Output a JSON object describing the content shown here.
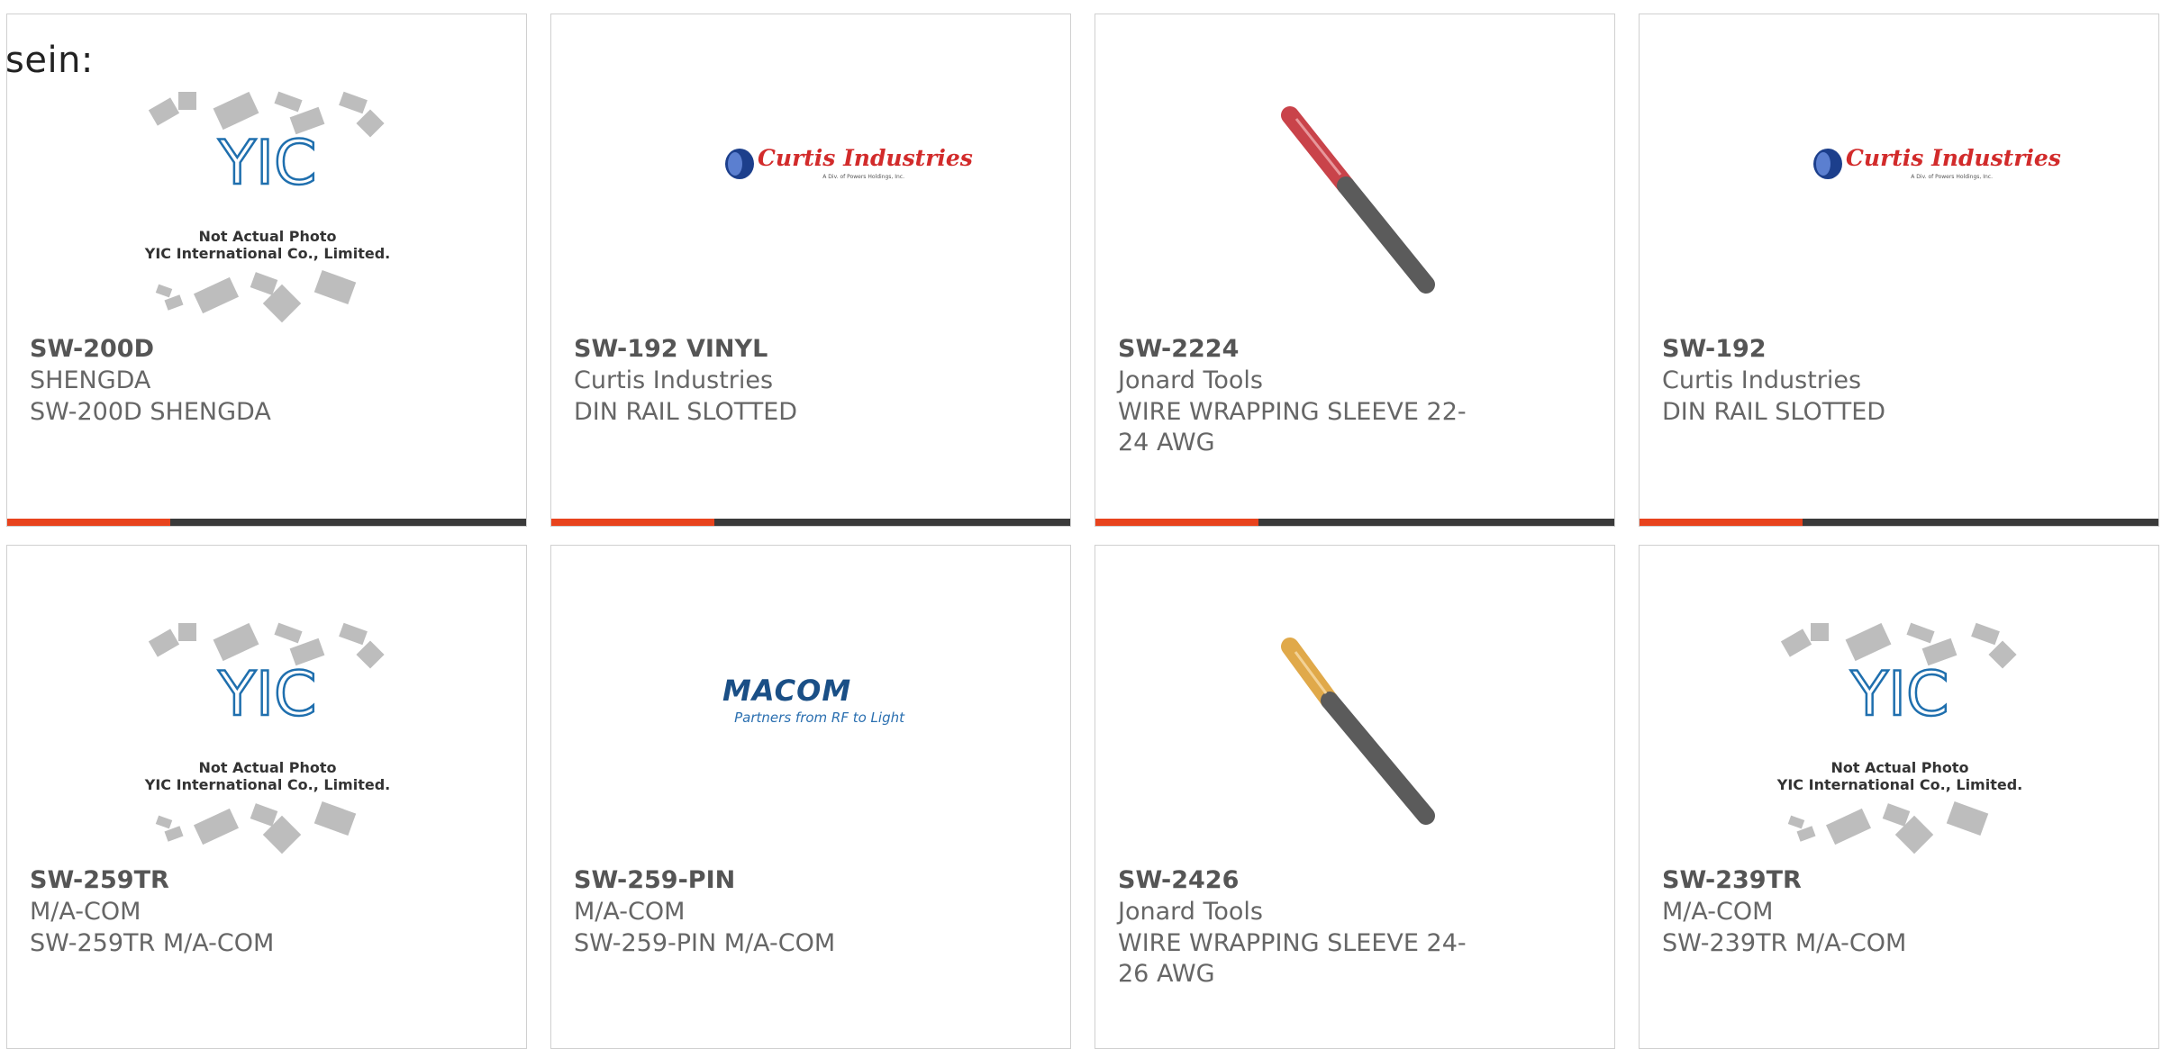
{
  "intro_text": "sein:",
  "accent_color": "#e8431d",
  "bar_color": "#3a3a3a",
  "products": [
    {
      "part": "SW-200D",
      "manufacturer": "SHENGDA",
      "description": "SW-200D SHENGDA",
      "image": "yic-placeholder",
      "yic_caption_1": "Not Actual Photo",
      "yic_caption_2": "YIC International Co., Limited."
    },
    {
      "part": "SW-192 VINYL",
      "manufacturer": "Curtis Industries",
      "description": "DIN RAIL SLOTTED",
      "image": "curtis-logo",
      "logo_text": "Curtis Industries",
      "logo_subtext": "A Div. of Powers Holdings, Inc."
    },
    {
      "part": "SW-2224",
      "manufacturer": "Jonard Tools",
      "description": "WIRE WRAPPING SLEEVE 22-24 AWG",
      "image": "sleeve-red"
    },
    {
      "part": "SW-192",
      "manufacturer": "Curtis Industries",
      "description": "DIN RAIL SLOTTED",
      "image": "curtis-logo",
      "logo_text": "Curtis Industries",
      "logo_subtext": "A Div. of Powers Holdings, Inc."
    },
    {
      "part": "SW-259TR",
      "manufacturer": "M/A-COM",
      "description": "SW-259TR M/A-COM",
      "image": "yic-placeholder",
      "yic_caption_1": "Not Actual Photo",
      "yic_caption_2": "YIC International Co., Limited."
    },
    {
      "part": "SW-259-PIN",
      "manufacturer": "M/A-COM",
      "description": "SW-259-PIN M/A-COM",
      "image": "macom-logo",
      "logo_text": "MACOM",
      "logo_subtext": "Partners from RF to Light"
    },
    {
      "part": "SW-2426",
      "manufacturer": "Jonard Tools",
      "description": "WIRE WRAPPING SLEEVE 24-26 AWG",
      "image": "sleeve-yellow"
    },
    {
      "part": "SW-239TR",
      "manufacturer": "M/A-COM",
      "description": "SW-239TR M/A-COM",
      "image": "yic-placeholder",
      "yic_caption_1": "Not Actual Photo",
      "yic_caption_2": "YIC International Co., Limited."
    }
  ]
}
